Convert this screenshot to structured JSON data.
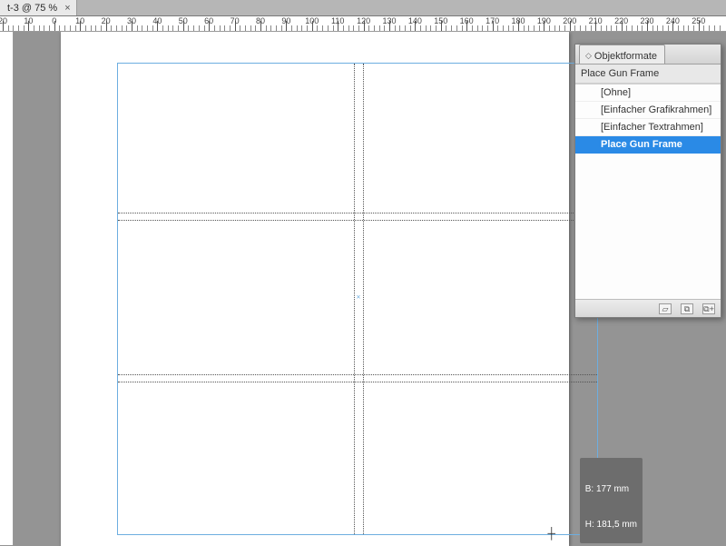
{
  "tab": {
    "title": "t-3 @ 75 %",
    "close": "×"
  },
  "ruler": {
    "labels": [
      "20",
      "10",
      "0",
      "10",
      "20",
      "30",
      "40",
      "50",
      "60",
      "70",
      "80",
      "90",
      "100",
      "110",
      "120",
      "130",
      "140",
      "150",
      "160",
      "170",
      "180",
      "190",
      "200",
      "210",
      "220",
      "230",
      "240",
      "250"
    ]
  },
  "panel": {
    "tab_label": "Objektformate",
    "subheading": "Place Gun Frame",
    "items": [
      {
        "label": "[Ohne]",
        "selected": false
      },
      {
        "label": "[Einfacher Grafikrahmen]",
        "selected": false
      },
      {
        "label": "[Einfacher Textrahmen]",
        "selected": false
      },
      {
        "label": "Place Gun Frame",
        "selected": true
      }
    ]
  },
  "tooltip": {
    "line1": "B: 177 mm",
    "line2": "H: 181,5 mm"
  },
  "icons": {
    "folder": "▱",
    "new": "⧉",
    "newplus": "⧉+"
  }
}
